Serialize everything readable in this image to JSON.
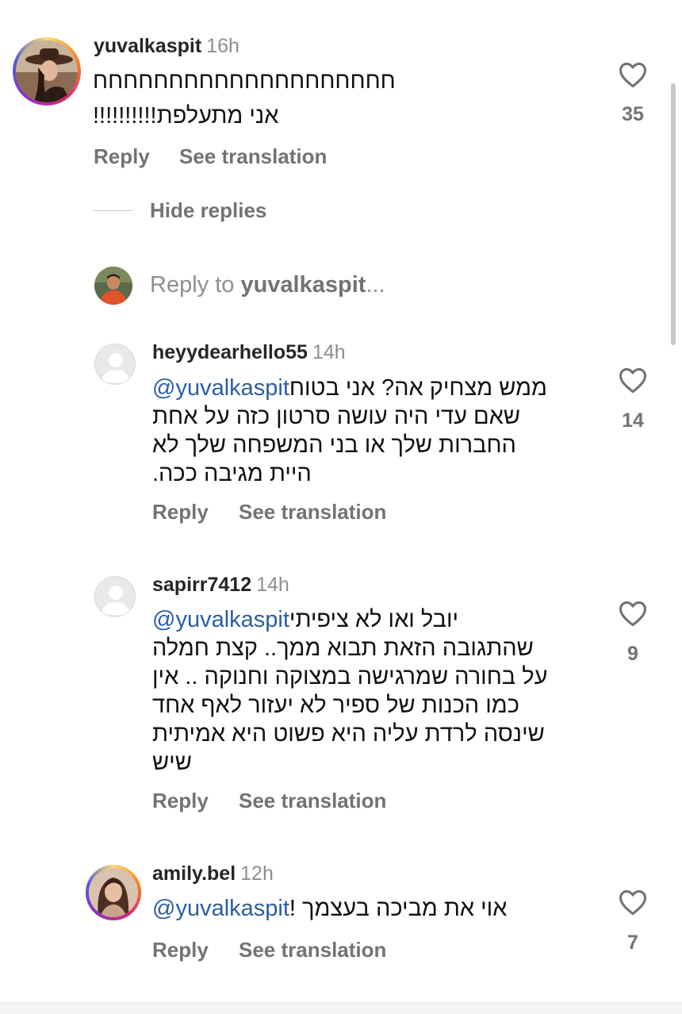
{
  "colors": {
    "mention": "#2b5f9e",
    "secondary": "#737373",
    "text": "#111111"
  },
  "thread": {
    "parent": {
      "username": "yuvalkaspit",
      "time": "16h",
      "lines": [
        "חחחחחחחחחחחחחחחחחחחח",
        "אני מתעלפת!!!!!!!!!!"
      ],
      "likes": "35",
      "reply_label": "Reply",
      "translate_label": "See translation"
    },
    "hide_replies_label": "Hide replies",
    "reply_box": {
      "prefix": "Reply to ",
      "target": "yuvalkaspit",
      "suffix": "..."
    },
    "replies": [
      {
        "username": "heyydearhello55",
        "time": "14h",
        "mention": "@yuvalkaspit",
        "first_line_text": " ממש מצחיק אה? אני בטוח",
        "lines": [
          "שאם עדי היה עושה סרטון כזה על אחת",
          "החברות שלך או בני המשפחה שלך לא",
          "היית מגיבה ככה."
        ],
        "likes": "14",
        "reply_label": "Reply",
        "translate_label": "See translation"
      },
      {
        "username": "sapirr7412",
        "time": "14h",
        "mention": "@yuvalkaspit",
        "first_line_text": " יובל ואו לא ציפיתי",
        "lines": [
          "שהתגובה הזאת תבוא ממך.. קצת חמלה",
          "על בחורה שמרגישה במצוקה וחנוקה .. אין",
          "כמו הכנות של ספיר לא יעזור לאף אחד",
          "שינסה לרדת עליה היא פשוט היא אמיתית",
          "שיש"
        ],
        "likes": "9",
        "reply_label": "Reply",
        "translate_label": "See translation"
      },
      {
        "username": "amily.bel",
        "time": "12h",
        "mention": "@yuvalkaspit",
        "first_line_text": " אוי את מביכה בעצמך !",
        "lines": [],
        "likes": "7",
        "reply_label": "Reply",
        "translate_label": "See translation"
      }
    ]
  }
}
